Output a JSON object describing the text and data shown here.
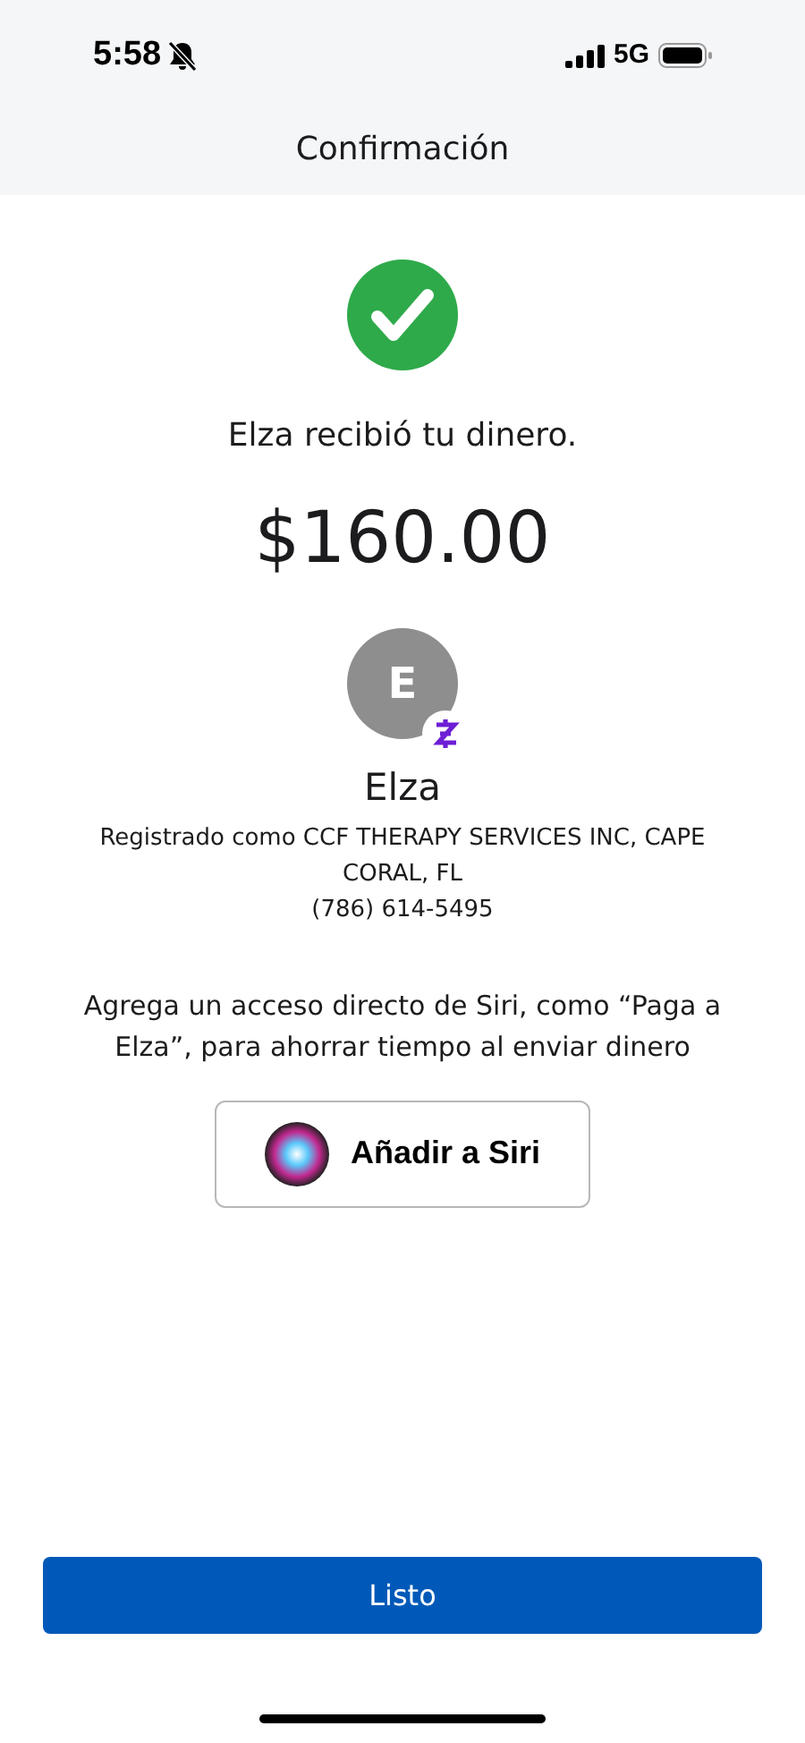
{
  "status_bar": {
    "time": "5:58",
    "network": "5G"
  },
  "header": {
    "title": "Confirmación"
  },
  "message": "Elza recibió tu dinero.",
  "amount": "$160.00",
  "recipient": {
    "initial": "E",
    "name": "Elza",
    "registration": "Registrado como CCF THERAPY SERVICES INC, CAPE CORAL, FL",
    "phone": "(786) 614-5495"
  },
  "siri": {
    "text": "Agrega un acceso directo de Siri, como “Paga a Elza”, para ahorrar tiempo al enviar dinero",
    "button": "Añadir a Siri"
  },
  "done_button": "Listo"
}
